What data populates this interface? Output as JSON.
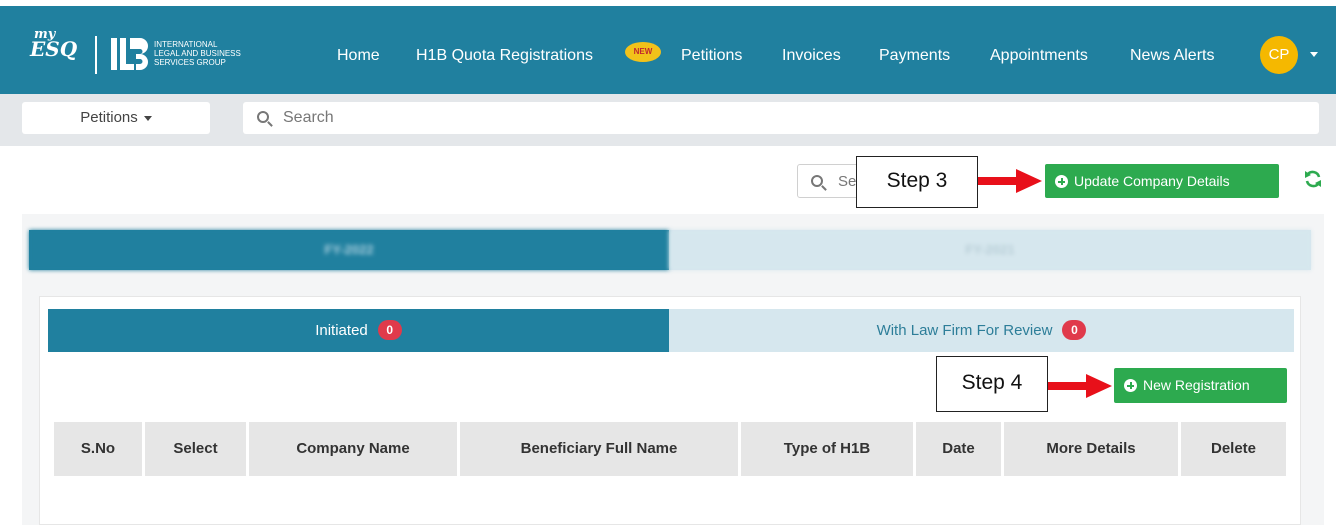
{
  "brand": {
    "logo_my": "my",
    "logo_esq": "ESQ",
    "company_text": [
      "INTERNATIONAL",
      "LEGAL AND BUSINESS",
      "SERVICES GROUP"
    ]
  },
  "nav": {
    "items": [
      "Home",
      "H1B Quota Registrations",
      "Petitions",
      "Invoices",
      "Payments",
      "Appointments",
      "News Alerts"
    ],
    "new_badge": "NEW",
    "avatar_initials": "CP"
  },
  "searchbar": {
    "module_select": "Petitions",
    "placeholder": "Search"
  },
  "toolbar": {
    "small_search_text": "Se",
    "update_button": "Update Company Details",
    "step3_label": "Step 3"
  },
  "fy_tabs": [
    "FY-2022",
    "FY-2021"
  ],
  "status_tabs": [
    {
      "label": "Initiated",
      "count": "0"
    },
    {
      "label": "With Law Firm For Review",
      "count": "0"
    }
  ],
  "actions": {
    "new_registration_button": "New Registration",
    "step4_label": "Step 4"
  },
  "table": {
    "columns": [
      "S.No",
      "Select",
      "Company Name",
      "Beneficiary Full Name",
      "Type of H1B",
      "Date",
      "More Details",
      "Delete"
    ]
  },
  "colors": {
    "header_bg": "#20809f",
    "action_green": "#2daa4f",
    "badge_red": "#e03a4b",
    "avatar_yellow": "#f5b800",
    "inactive_tab": "#d6e7ee"
  }
}
